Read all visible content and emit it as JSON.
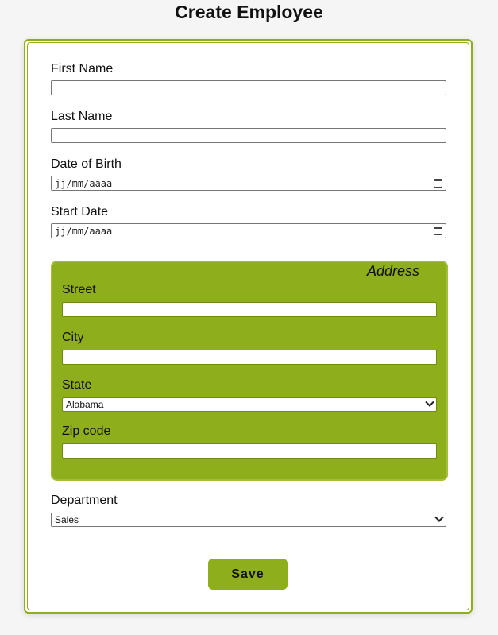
{
  "page": {
    "title": "Create Employee"
  },
  "form": {
    "first_name": {
      "label": "First Name",
      "value": ""
    },
    "last_name": {
      "label": "Last Name",
      "value": ""
    },
    "date_of_birth": {
      "label": "Date of Birth",
      "placeholder": "jj/mm/aaaa"
    },
    "start_date": {
      "label": "Start Date",
      "placeholder": "jj/mm/aaaa"
    },
    "address": {
      "legend": "Address",
      "street": {
        "label": "Street",
        "value": ""
      },
      "city": {
        "label": "City",
        "value": ""
      },
      "state": {
        "label": "State",
        "selected": "Alabama"
      },
      "zip": {
        "label": "Zip code",
        "value": ""
      }
    },
    "department": {
      "label": "Department",
      "selected": "Sales"
    },
    "save_label": "Save"
  },
  "colors": {
    "accent": "#8fae1b",
    "address_bg": "#8fae1b",
    "page_bg": "#f4f5f4"
  },
  "icons": {
    "date_picker": "calendar-icon",
    "dropdown": "chevron-down-icon"
  }
}
